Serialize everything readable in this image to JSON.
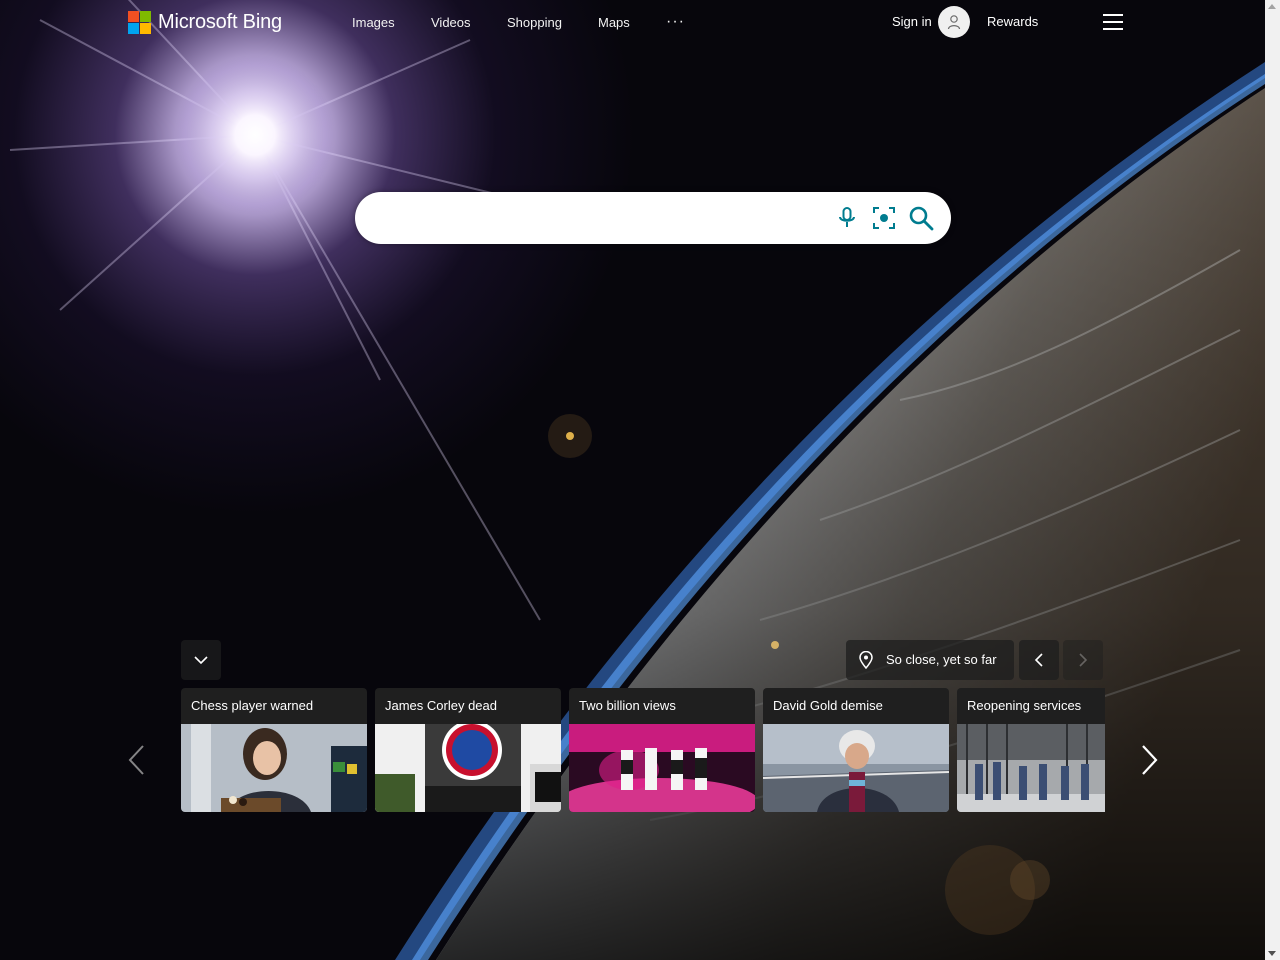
{
  "brand": {
    "name": "Microsoft Bing",
    "logo_colors": [
      "#f25022",
      "#7fba00",
      "#00a4ef",
      "#ffb900"
    ]
  },
  "nav": {
    "items": [
      {
        "label": "Images"
      },
      {
        "label": "Videos"
      },
      {
        "label": "Shopping"
      },
      {
        "label": "Maps"
      }
    ],
    "more_label": "···"
  },
  "account": {
    "signin_label": "Sign in",
    "rewards_label": "Rewards"
  },
  "search": {
    "value": "",
    "placeholder": "",
    "accent_color": "#007c8f"
  },
  "image_of_day": {
    "location_label": "So close, yet so far"
  },
  "news": {
    "cards": [
      {
        "title": "Chess player warned"
      },
      {
        "title": "James Corley dead"
      },
      {
        "title": "Two billion views"
      },
      {
        "title": "David Gold demise"
      },
      {
        "title": "Reopening services"
      }
    ]
  },
  "icons": {
    "mic": "microphone-icon",
    "visual_search": "visual-search-icon",
    "search": "search-icon",
    "menu": "hamburger-menu-icon",
    "location": "location-pin-icon"
  }
}
